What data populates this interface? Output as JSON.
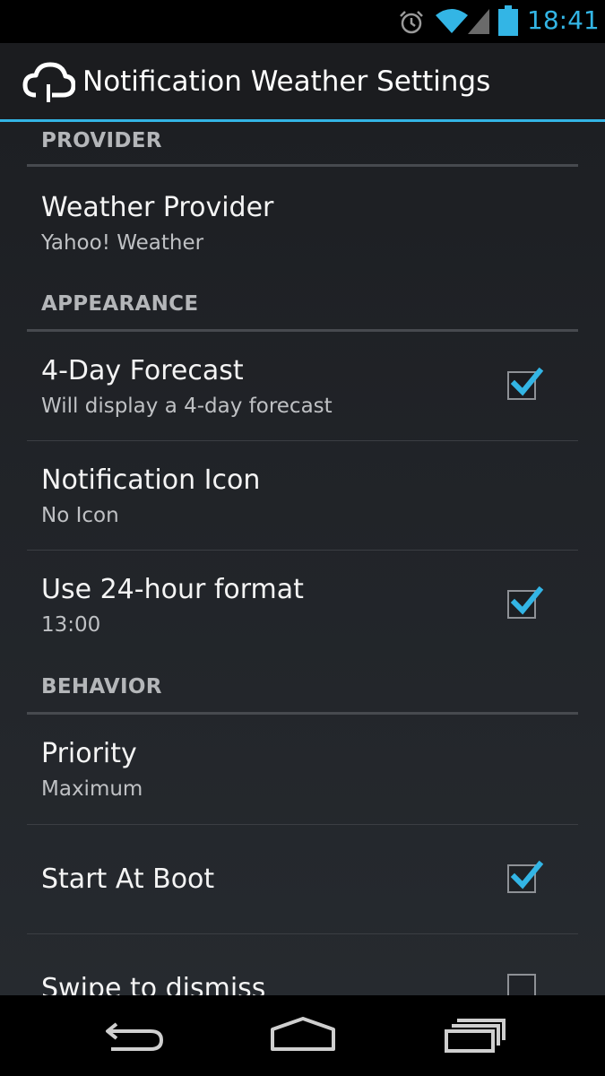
{
  "status_bar": {
    "time": "18:41",
    "icons": [
      "alarm-icon",
      "wifi-icon",
      "signal-icon",
      "battery-icon"
    ],
    "accent_color": "#33b5e5"
  },
  "action_bar": {
    "title": "Notification Weather Settings",
    "icon": "cloud-app-icon"
  },
  "sections": {
    "provider": {
      "label": "PROVIDER",
      "weather_provider": {
        "title": "Weather Provider",
        "summary": "Yahoo! Weather"
      }
    },
    "appearance": {
      "label": "APPEARANCE",
      "forecast": {
        "title": "4-Day Forecast",
        "summary": "Will display a 4-day forecast",
        "checked": true
      },
      "notification_icon": {
        "title": "Notification Icon",
        "summary": "No Icon"
      },
      "hour_format": {
        "title": "Use 24-hour format",
        "summary": "13:00",
        "checked": true
      }
    },
    "behavior": {
      "label": "BEHAVIOR",
      "priority": {
        "title": "Priority",
        "summary": "Maximum"
      },
      "start_at_boot": {
        "title": "Start At Boot",
        "checked": true
      },
      "swipe_to_dismiss": {
        "title": "Swipe to dismiss",
        "checked": false
      }
    }
  },
  "nav_bar": {
    "buttons": [
      "back-icon",
      "home-icon",
      "recent-apps-icon"
    ]
  }
}
